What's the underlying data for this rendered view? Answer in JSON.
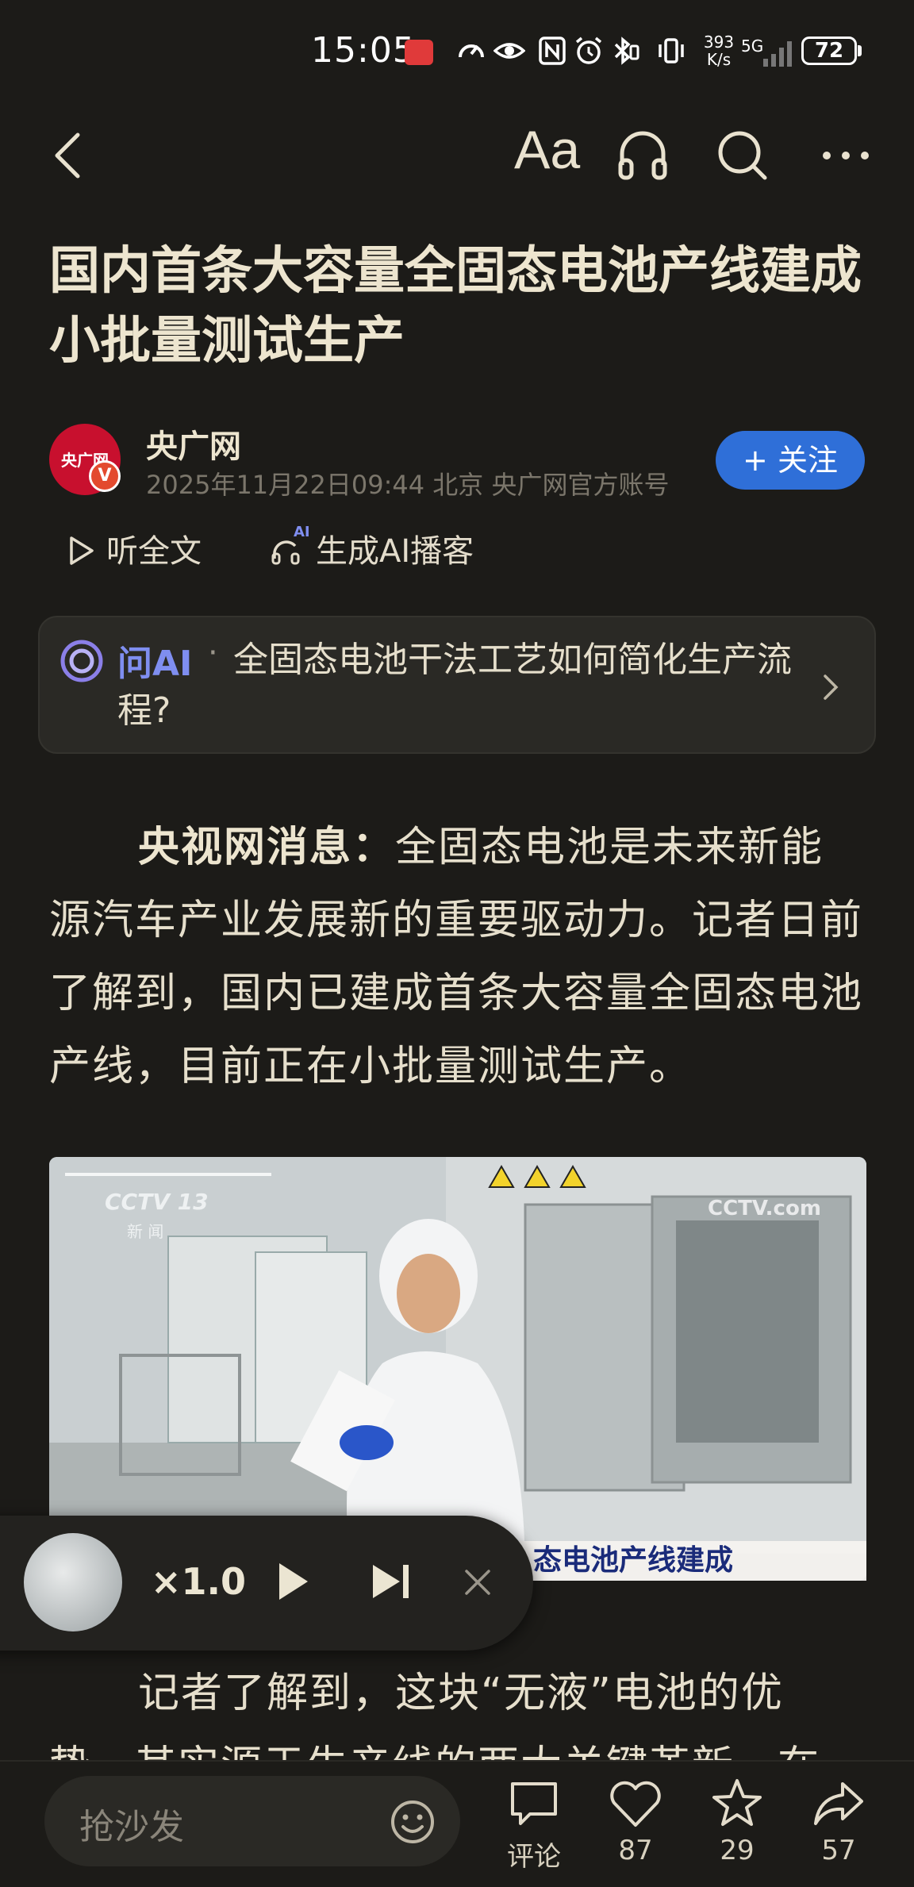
{
  "status_bar": {
    "time": "15:05",
    "net_speed_value": "393",
    "net_speed_unit": "K/s",
    "network": "5G",
    "battery": "72"
  },
  "toolbar": {
    "font_size_label": "Aa"
  },
  "article": {
    "title": "国内首条大容量全固态电池产线建成 小批量测试生产",
    "author": "央广网",
    "avatar_text": "央广网",
    "verified_mark": "V",
    "meta": "2025年11月22日09:44 北京 央广网官方账号",
    "follow_label": "+ 关注",
    "listen_full_label": "听全文",
    "ai_podcast_label": "生成AI播客",
    "ai_badge": "AI"
  },
  "ask_ai": {
    "label": "问AI",
    "separator": "·",
    "question": "全固态电池干法工艺如何简化生产流程?"
  },
  "body": {
    "para1_lead": "央视网消息：",
    "para1_text": "全固态电池是未来新能源汽车产业发展新的重要驱动力。记者日前了解到，国内已建成首条大容量全固态电池产线，目前正在小批量测试生产。",
    "para2_text": "记者了解到，这块“无液”电池的优势，其实源于生产线的两大关键革新。在"
  },
  "video": {
    "channel_logo": "CCTV 13",
    "channel_sub": "新 闻",
    "watermark": "CCTV.com",
    "caption": "态电池产线建成"
  },
  "player": {
    "speed": "×1.0"
  },
  "bottom_bar": {
    "comment_placeholder": "抢沙发",
    "comment_label": "评论",
    "like_count": "87",
    "favorite_count": "29",
    "share_count": "57"
  },
  "colors": {
    "background": "#1c1b18",
    "follow_button": "#2f6fd8",
    "ai_accent": "#7f8ef0",
    "text": "#e6dfcc"
  }
}
